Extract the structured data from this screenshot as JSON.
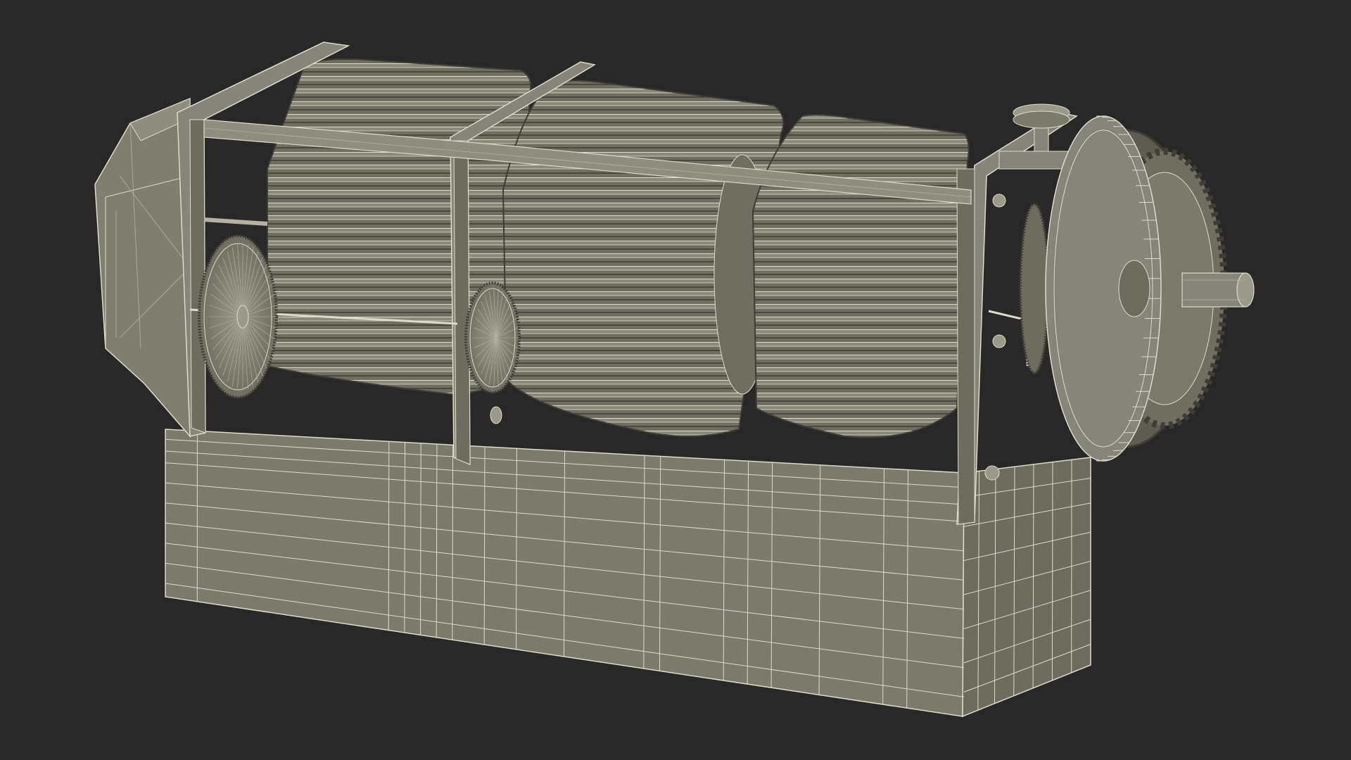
{
  "scene": {
    "background_color": "#282828",
    "model_base_color": "#7b7a6b",
    "model_shadow_color": "#5a594e",
    "model_dark_color": "#3e3d36",
    "wire_color": "#dcdccb",
    "wire_dim_color": "#b3b2a3",
    "components": [
      "base-block",
      "motor-housing",
      "side-plate-left",
      "side-plate-middle",
      "side-plate-right",
      "cylinder-left",
      "cylinder-middle",
      "cylinder-right",
      "large-gear-left",
      "large-gear-middle",
      "tie-rod-upper",
      "tie-rod-lower",
      "crank-knob",
      "drum-wheel",
      "ratchet-gear",
      "drive-shaft"
    ]
  }
}
